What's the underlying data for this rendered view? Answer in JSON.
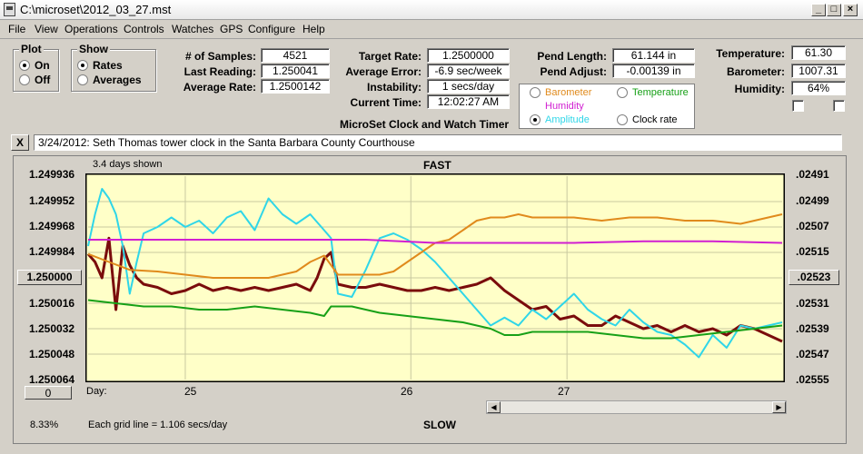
{
  "window": {
    "title": "C:\\microset\\2012_03_27.mst"
  },
  "menu": [
    "File",
    "View",
    "Operations",
    "Controls",
    "Watches",
    "GPS",
    "Configure",
    "Help"
  ],
  "plot_group": {
    "title": "Plot",
    "on": "On",
    "off": "Off",
    "selected": "On"
  },
  "show_group": {
    "title": "Show",
    "rates": "Rates",
    "averages": "Averages",
    "selected": "Rates"
  },
  "stats": {
    "samples_label": "# of Samples:",
    "samples": "4521",
    "last_label": "Last Reading:",
    "last": "1.250041",
    "avg_label": "Average Rate:",
    "avg": "1.2500142"
  },
  "rates": {
    "target_label": "Target Rate:",
    "target": "1.2500000",
    "error_label": "Average Error:",
    "error": "-6.9 sec/week",
    "instab_label": "Instability:",
    "instab": "1 secs/day",
    "time_label": "Current Time:",
    "time": "12:02:27 AM"
  },
  "pend": {
    "length_label": "Pend Length:",
    "length": "61.144 in",
    "adjust_label": "Pend Adjust:",
    "adjust": "-0.00139 in"
  },
  "env": {
    "temp_label": "Temperature:",
    "temp": "61.30",
    "baro_label": "Barometer:",
    "baro": "1007.31",
    "hum_label": "Humidity:",
    "hum": "64%"
  },
  "plot_choices": {
    "barometer": "Barometer",
    "temperature": "Temperature",
    "humidity": "Humidity",
    "amplitude": "Amplitude",
    "clock_rate": "Clock rate",
    "selected": "Amplitude",
    "colors": {
      "barometer": "#e08a1c",
      "temperature": "#17a017",
      "humidity": "#d11fd1",
      "amplitude": "#2fd6e8"
    }
  },
  "app_title": "MicroSet Clock and Watch Timer",
  "note_button": "X",
  "note": "3/24/2012: Seth Thomas tower clock in the Santa Barbara County Courthouse",
  "chart_labels": {
    "days_shown": "3.4 days shown",
    "fast": "FAST",
    "slow": "SLOW",
    "day_label": "Day:",
    "grid": "Each grid line = 1.106 secs/day",
    "percent": "8.33%",
    "left_button": "1.250000",
    "right_button": ".02523",
    "zero_button": "0"
  },
  "chart_data": {
    "type": "line",
    "x_label": "Day",
    "day_ticks": [
      "25",
      "26",
      "27"
    ],
    "left_axis": [
      "1.249936",
      "1.249952",
      "1.249968",
      "1.249984",
      "1.250000",
      "1.250016",
      "1.250032",
      "1.250048",
      "1.250064"
    ],
    "right_axis": [
      ".02491",
      ".02499",
      ".02507",
      ".02515",
      ".02523",
      ".02531",
      ".02539",
      ".02547",
      ".02555"
    ],
    "ylim": [
      1.249936,
      1.250064
    ],
    "x_range": [
      0,
      100
    ],
    "series": [
      {
        "color": "#7a0c0c",
        "points": [
          [
            0,
            1.249985
          ],
          [
            1,
            1.24999
          ],
          [
            2,
            1.25
          ],
          [
            3,
            1.249975
          ],
          [
            4,
            1.25002
          ],
          [
            5,
            1.24998
          ],
          [
            6,
            1.249992
          ],
          [
            7,
            1.25
          ],
          [
            8,
            1.250004
          ],
          [
            10,
            1.250006
          ],
          [
            12,
            1.25001
          ],
          [
            14,
            1.250008
          ],
          [
            16,
            1.250004
          ],
          [
            18,
            1.250008
          ],
          [
            20,
            1.250006
          ],
          [
            22,
            1.250008
          ],
          [
            24,
            1.250006
          ],
          [
            26,
            1.250008
          ],
          [
            28,
            1.250006
          ],
          [
            30,
            1.250004
          ],
          [
            32,
            1.250008
          ],
          [
            33,
            1.25
          ],
          [
            34,
            1.249988
          ],
          [
            35,
            1.249984
          ],
          [
            36,
            1.250004
          ],
          [
            38,
            1.250006
          ],
          [
            40,
            1.250006
          ],
          [
            42,
            1.250004
          ],
          [
            44,
            1.250006
          ],
          [
            46,
            1.250008
          ],
          [
            48,
            1.250008
          ],
          [
            50,
            1.250006
          ],
          [
            52,
            1.250008
          ],
          [
            54,
            1.250006
          ],
          [
            56,
            1.250004
          ],
          [
            58,
            1.25
          ],
          [
            60,
            1.250008
          ],
          [
            62,
            1.250014
          ],
          [
            64,
            1.25002
          ],
          [
            66,
            1.250018
          ],
          [
            68,
            1.250026
          ],
          [
            70,
            1.250024
          ],
          [
            72,
            1.25003
          ],
          [
            74,
            1.25003
          ],
          [
            76,
            1.250024
          ],
          [
            78,
            1.250028
          ],
          [
            80,
            1.250032
          ],
          [
            82,
            1.25003
          ],
          [
            84,
            1.250034
          ],
          [
            86,
            1.25003
          ],
          [
            88,
            1.250034
          ],
          [
            90,
            1.250032
          ],
          [
            92,
            1.250036
          ],
          [
            94,
            1.25003
          ],
          [
            96,
            1.250032
          ],
          [
            98,
            1.250036
          ],
          [
            100,
            1.25004
          ]
        ]
      },
      {
        "color": "#2fd6e8",
        "points": [
          [
            0,
            1.24998
          ],
          [
            1,
            1.24996
          ],
          [
            2,
            1.249944
          ],
          [
            3,
            1.24995
          ],
          [
            4,
            1.24996
          ],
          [
            5,
            1.24998
          ],
          [
            6,
            1.25001
          ],
          [
            7,
            1.24999
          ],
          [
            8,
            1.249972
          ],
          [
            10,
            1.249968
          ],
          [
            12,
            1.249962
          ],
          [
            14,
            1.249968
          ],
          [
            16,
            1.249964
          ],
          [
            18,
            1.249972
          ],
          [
            20,
            1.249962
          ],
          [
            22,
            1.249958
          ],
          [
            24,
            1.24997
          ],
          [
            26,
            1.24995
          ],
          [
            28,
            1.24996
          ],
          [
            30,
            1.249966
          ],
          [
            32,
            1.24996
          ],
          [
            34,
            1.24997
          ],
          [
            35,
            1.249975
          ],
          [
            36,
            1.25001
          ],
          [
            38,
            1.250012
          ],
          [
            40,
            1.249995
          ],
          [
            42,
            1.249975
          ],
          [
            44,
            1.249972
          ],
          [
            46,
            1.249976
          ],
          [
            48,
            1.249982
          ],
          [
            50,
            1.24999
          ],
          [
            52,
            1.25
          ],
          [
            54,
            1.25001
          ],
          [
            56,
            1.25002
          ],
          [
            58,
            1.25003
          ],
          [
            60,
            1.250025
          ],
          [
            62,
            1.25003
          ],
          [
            64,
            1.25002
          ],
          [
            66,
            1.250026
          ],
          [
            68,
            1.250018
          ],
          [
            70,
            1.25001
          ],
          [
            72,
            1.25002
          ],
          [
            74,
            1.250026
          ],
          [
            76,
            1.25003
          ],
          [
            78,
            1.25002
          ],
          [
            80,
            1.250028
          ],
          [
            82,
            1.250034
          ],
          [
            84,
            1.250036
          ],
          [
            86,
            1.250042
          ],
          [
            88,
            1.25005
          ],
          [
            90,
            1.250036
          ],
          [
            92,
            1.250044
          ],
          [
            94,
            1.25003
          ],
          [
            96,
            1.250032
          ],
          [
            98,
            1.25003
          ],
          [
            100,
            1.250028
          ]
        ]
      },
      {
        "color": "#e08a1c",
        "points": [
          [
            0,
            1.249985
          ],
          [
            3,
            1.24999
          ],
          [
            6,
            1.249995
          ],
          [
            10,
            1.249996
          ],
          [
            14,
            1.249998
          ],
          [
            18,
            1.25
          ],
          [
            22,
            1.25
          ],
          [
            26,
            1.25
          ],
          [
            30,
            1.249996
          ],
          [
            32,
            1.24999
          ],
          [
            34,
            1.249986
          ],
          [
            36,
            1.249998
          ],
          [
            38,
            1.249998
          ],
          [
            40,
            1.249998
          ],
          [
            42,
            1.249998
          ],
          [
            44,
            1.249996
          ],
          [
            46,
            1.24999
          ],
          [
            48,
            1.249984
          ],
          [
            50,
            1.249978
          ],
          [
            52,
            1.249976
          ],
          [
            54,
            1.24997
          ],
          [
            56,
            1.249964
          ],
          [
            58,
            1.249962
          ],
          [
            60,
            1.249962
          ],
          [
            62,
            1.24996
          ],
          [
            64,
            1.249962
          ],
          [
            66,
            1.249962
          ],
          [
            70,
            1.249962
          ],
          [
            74,
            1.249964
          ],
          [
            78,
            1.249962
          ],
          [
            82,
            1.249962
          ],
          [
            86,
            1.249964
          ],
          [
            90,
            1.249964
          ],
          [
            94,
            1.249966
          ],
          [
            98,
            1.249962
          ],
          [
            100,
            1.24996
          ]
        ]
      },
      {
        "color": "#d11fd1",
        "points": [
          [
            0,
            1.249976
          ],
          [
            10,
            1.249976
          ],
          [
            20,
            1.249976
          ],
          [
            30,
            1.249976
          ],
          [
            40,
            1.249976
          ],
          [
            50,
            1.249978
          ],
          [
            60,
            1.249978
          ],
          [
            70,
            1.249978
          ],
          [
            80,
            1.249977
          ],
          [
            90,
            1.249977
          ],
          [
            100,
            1.249978
          ]
        ]
      },
      {
        "color": "#17a017",
        "points": [
          [
            0,
            1.250014
          ],
          [
            4,
            1.250016
          ],
          [
            8,
            1.250018
          ],
          [
            12,
            1.250018
          ],
          [
            16,
            1.25002
          ],
          [
            20,
            1.25002
          ],
          [
            24,
            1.250018
          ],
          [
            28,
            1.25002
          ],
          [
            32,
            1.250022
          ],
          [
            34,
            1.250024
          ],
          [
            35,
            1.250018
          ],
          [
            38,
            1.250018
          ],
          [
            42,
            1.250022
          ],
          [
            46,
            1.250024
          ],
          [
            50,
            1.250026
          ],
          [
            54,
            1.250028
          ],
          [
            58,
            1.250032
          ],
          [
            60,
            1.250036
          ],
          [
            62,
            1.250036
          ],
          [
            64,
            1.250034
          ],
          [
            68,
            1.250034
          ],
          [
            72,
            1.250034
          ],
          [
            76,
            1.250036
          ],
          [
            80,
            1.250038
          ],
          [
            84,
            1.250038
          ],
          [
            88,
            1.250036
          ],
          [
            92,
            1.250034
          ],
          [
            96,
            1.250032
          ],
          [
            100,
            1.25003
          ]
        ]
      }
    ]
  }
}
